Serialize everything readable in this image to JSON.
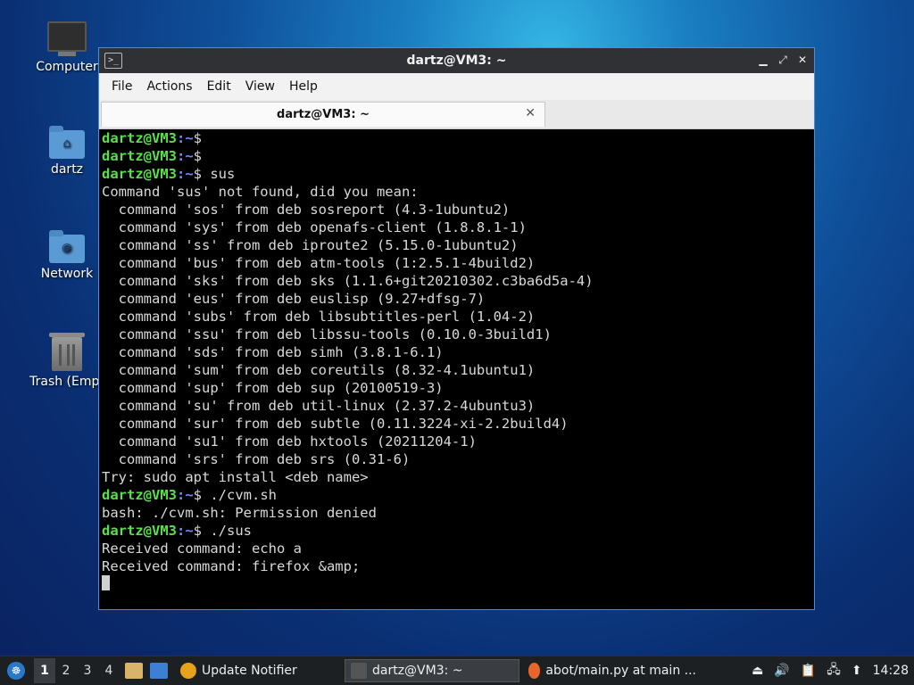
{
  "desktop": {
    "icons": [
      {
        "label": "Computer"
      },
      {
        "label": "dartz"
      },
      {
        "label": "Network"
      },
      {
        "label": "Trash (Empt"
      }
    ]
  },
  "window": {
    "title": "dartz@VM3: ~",
    "menu": [
      "File",
      "Actions",
      "Edit",
      "View",
      "Help"
    ],
    "tab_label": "dartz@VM3: ~",
    "prompt_host": "dartz@VM3",
    "prompt_path": ":~",
    "prompt_sign": "$",
    "lines": [
      {
        "type": "prompt",
        "cmd": ""
      },
      {
        "type": "prompt",
        "cmd": ""
      },
      {
        "type": "prompt",
        "cmd": " sus"
      },
      {
        "type": "out",
        "text": "Command 'sus' not found, did you mean:"
      },
      {
        "type": "out",
        "text": "  command 'sos' from deb sosreport (4.3-1ubuntu2)"
      },
      {
        "type": "out",
        "text": "  command 'sys' from deb openafs-client (1.8.8.1-1)"
      },
      {
        "type": "out",
        "text": "  command 'ss' from deb iproute2 (5.15.0-1ubuntu2)"
      },
      {
        "type": "out",
        "text": "  command 'bus' from deb atm-tools (1:2.5.1-4build2)"
      },
      {
        "type": "out",
        "text": "  command 'sks' from deb sks (1.1.6+git20210302.c3ba6d5a-4)"
      },
      {
        "type": "out",
        "text": "  command 'eus' from deb euslisp (9.27+dfsg-7)"
      },
      {
        "type": "out",
        "text": "  command 'subs' from deb libsubtitles-perl (1.04-2)"
      },
      {
        "type": "out",
        "text": "  command 'ssu' from deb libssu-tools (0.10.0-3build1)"
      },
      {
        "type": "out",
        "text": "  command 'sds' from deb simh (3.8.1-6.1)"
      },
      {
        "type": "out",
        "text": "  command 'sum' from deb coreutils (8.32-4.1ubuntu1)"
      },
      {
        "type": "out",
        "text": "  command 'sup' from deb sup (20100519-3)"
      },
      {
        "type": "out",
        "text": "  command 'su' from deb util-linux (2.37.2-4ubuntu3)"
      },
      {
        "type": "out",
        "text": "  command 'sur' from deb subtle (0.11.3224-xi-2.2build4)"
      },
      {
        "type": "out",
        "text": "  command 'su1' from deb hxtools (20211204-1)"
      },
      {
        "type": "out",
        "text": "  command 'srs' from deb srs (0.31-6)"
      },
      {
        "type": "out",
        "text": "Try: sudo apt install <deb name>"
      },
      {
        "type": "prompt",
        "cmd": " ./cvm.sh"
      },
      {
        "type": "out",
        "text": "bash: ./cvm.sh: Permission denied"
      },
      {
        "type": "prompt",
        "cmd": " ./sus"
      },
      {
        "type": "out",
        "text": "Received command: echo a"
      },
      {
        "type": "out",
        "text": "Received command: firefox &amp;"
      },
      {
        "type": "cursor"
      }
    ]
  },
  "taskbar": {
    "workspaces": [
      "1",
      "2",
      "3",
      "4"
    ],
    "tasks": [
      {
        "label": "Update Notifier",
        "icon": "update-notifier-icon"
      },
      {
        "label": "dartz@VM3: ~",
        "icon": "terminal-icon"
      },
      {
        "label": "abot/main.py at main ...",
        "icon": "firefox-icon"
      }
    ],
    "clock": "14:28"
  },
  "colors": {
    "prompt_host": "#58e04a",
    "prompt_path": "#6a8cff",
    "terminal_bg": "#000000",
    "taskbar_bg": "#1d2023"
  }
}
